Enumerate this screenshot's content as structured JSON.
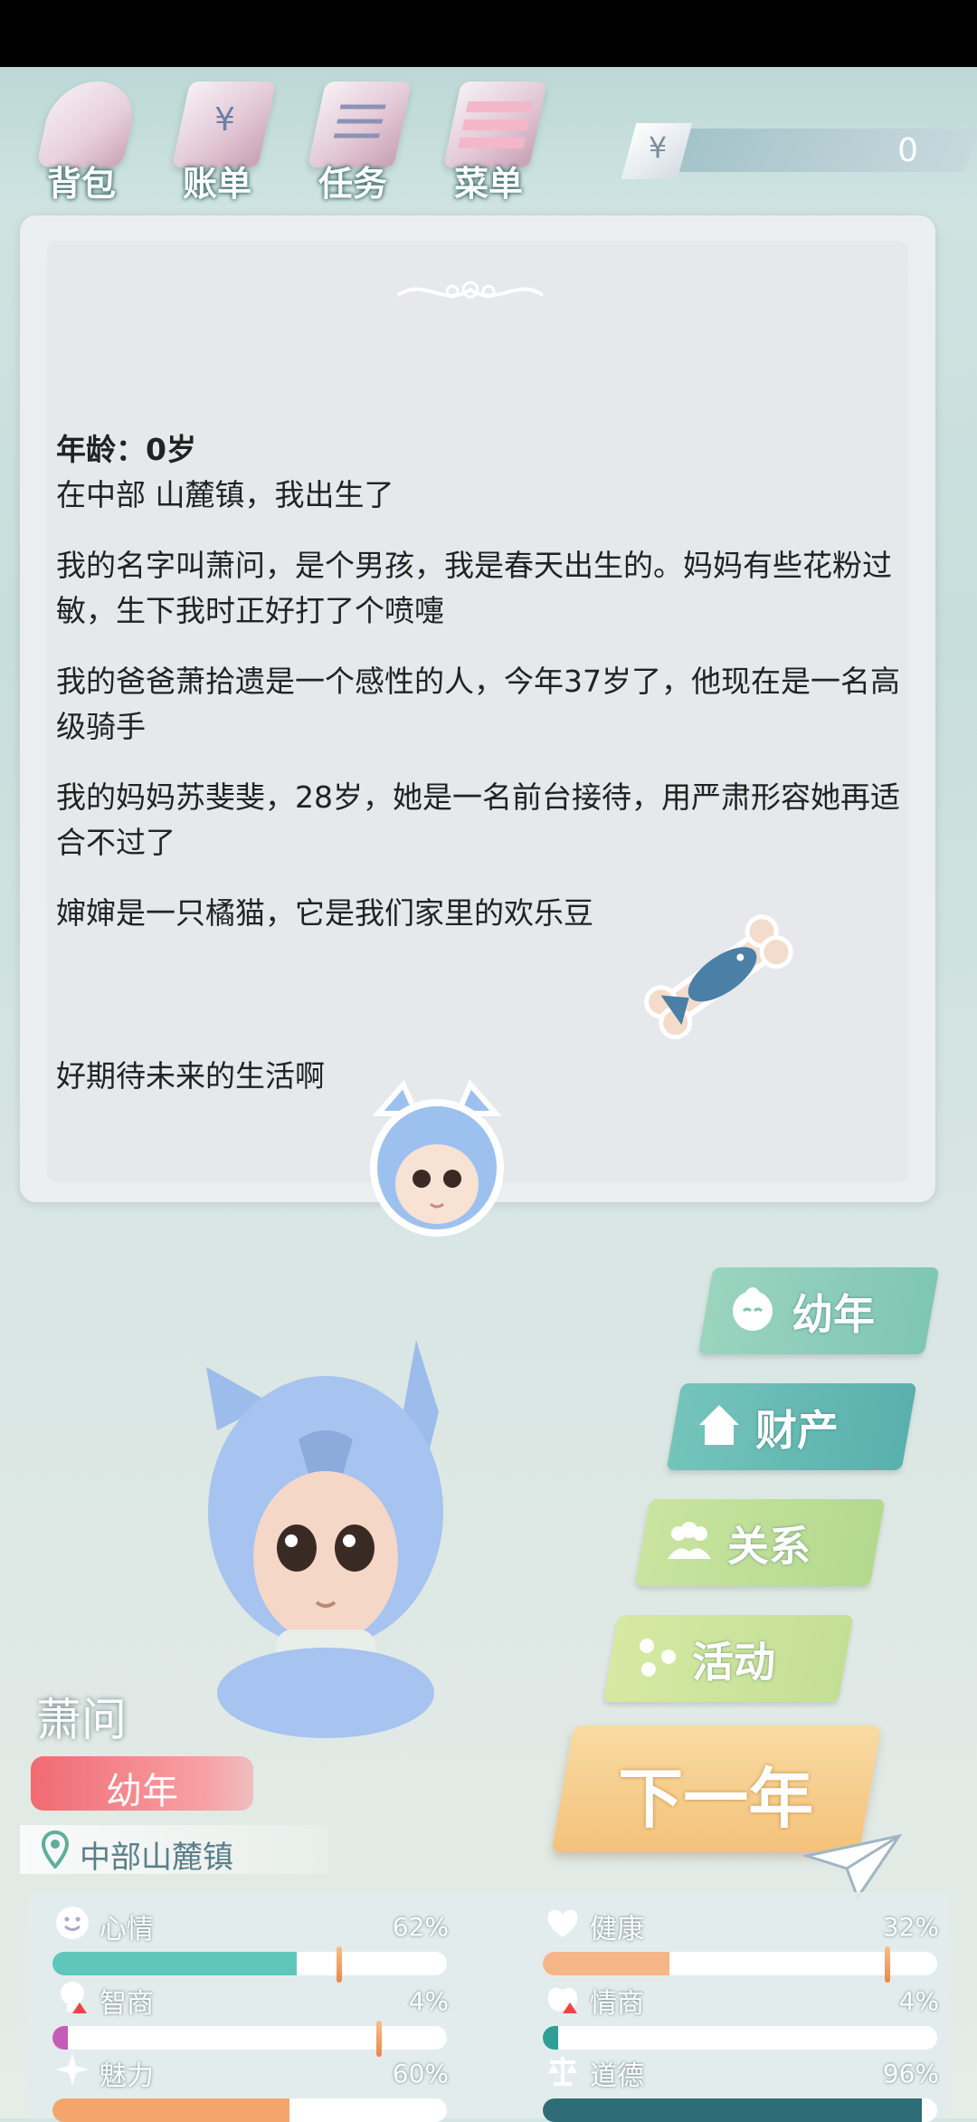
{
  "nav": {
    "items": [
      {
        "label": "背包",
        "icon": "bag-icon"
      },
      {
        "label": "账单",
        "icon": "bill-icon"
      },
      {
        "label": "任务",
        "icon": "task-icon"
      },
      {
        "label": "菜单",
        "icon": "menu-icon"
      }
    ],
    "currency_symbol": "¥",
    "money": "0"
  },
  "story": {
    "age_line": "年龄：0岁",
    "paragraphs": [
      "在中部 山麓镇，我出生了",
      "我的名字叫萧问，是个男孩，我是春天出生的。妈妈有些花粉过敏，生下我时正好打了个喷嚏",
      "我的爸爸萧拾遗是一个感性的人，今年37岁了，他现在是一名高级骑手",
      "我的妈妈苏斐斐，28岁，她是一名前台接待，用严肃形容她再适合不过了",
      "婶婶是一只橘猫，它是我们家里的欢乐豆"
    ],
    "closing": "好期待未来的生活啊"
  },
  "menu": {
    "childhood": "幼年",
    "property": "财产",
    "relations": "关系",
    "activities": "活动",
    "next_year": "下一年"
  },
  "character": {
    "name": "萧问",
    "stage": "幼年",
    "location": "中部山麓镇"
  },
  "stats": [
    {
      "name": "心情",
      "pct": "62%",
      "value": 0.62,
      "color": "#5ec6bb",
      "icon": "smile-icon"
    },
    {
      "name": "健康",
      "pct": "32%",
      "value": 0.32,
      "color": "#f6b586",
      "icon": "heart-icon"
    },
    {
      "name": "智商",
      "pct": "4%",
      "value": 0.04,
      "color": "#c55db8",
      "icon": "bulb-icon"
    },
    {
      "name": "情商",
      "pct": "4%",
      "value": 0.04,
      "color": "#2f9f96",
      "icon": "apple-icon"
    },
    {
      "name": "魅力",
      "pct": "60%",
      "value": 0.6,
      "color": "#f4a56c",
      "icon": "sparkle-icon"
    },
    {
      "name": "道德",
      "pct": "96%",
      "value": 0.96,
      "color": "#2e6d78",
      "icon": "scale-icon"
    }
  ]
}
